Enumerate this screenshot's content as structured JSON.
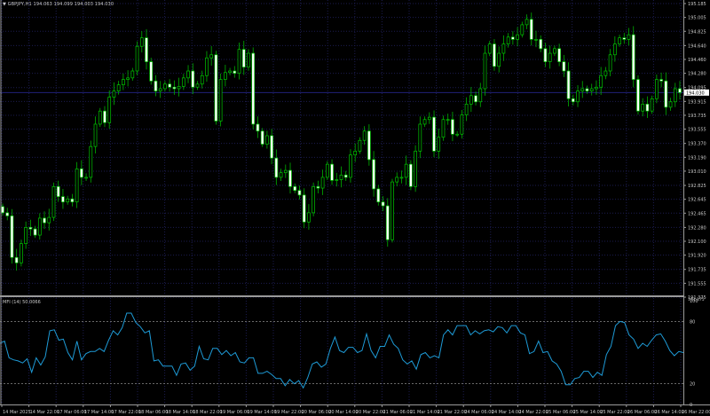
{
  "header": {
    "collapse_icon": "triangle-down-icon",
    "symbol": "GBPJPY,H1",
    "ohlc": "194.063 194.099 194.003 194.030"
  },
  "colors": {
    "background": "#000000",
    "grid": "#1c1c50",
    "candle_bull": "#00c800",
    "candle_bear_fill": "#ffffff",
    "wick": "#00b000",
    "mfi_line": "#1e9bd7",
    "current_price_line": "#20207a",
    "axis_text": "#c8c8c8"
  },
  "price_axis": {
    "labels": [
      "195.185",
      "195.005",
      "194.825",
      "194.640",
      "194.460",
      "194.280",
      "194.095",
      "193.915",
      "193.735",
      "193.555",
      "193.370",
      "193.190",
      "193.010",
      "192.825",
      "192.645",
      "192.465",
      "192.280",
      "192.100",
      "191.920",
      "191.735",
      "191.555",
      "191.375"
    ],
    "current_price": "194.030",
    "range": [
      191.375,
      195.185
    ]
  },
  "indicator": {
    "label": "MFI (14) 50.0066",
    "axis_labels": [
      "100",
      "80",
      "20",
      "0"
    ],
    "levels": [
      80,
      20
    ],
    "range": [
      0,
      100
    ],
    "sub_axis_top_label": "191.375"
  },
  "time_axis": {
    "labels": [
      "14 Mar 2025",
      "14 Mar 22:00",
      "17 Mar 06:00",
      "17 Mar 14:00",
      "17 Mar 22:00",
      "18 Mar 06:00",
      "18 Mar 14:00",
      "18 Mar 22:00",
      "19 Mar 06:00",
      "19 Mar 14:00",
      "19 Mar 22:00",
      "20 Mar 06:00",
      "20 Mar 14:00",
      "20 Mar 22:00",
      "21 Mar 06:00",
      "21 Mar 14:00",
      "21 Mar 22:00",
      "24 Mar 06:00",
      "24 Mar 14:00",
      "24 Mar 22:00",
      "25 Mar 06:00",
      "25 Mar 14:00",
      "25 Mar 22:00",
      "26 Mar 06:00",
      "26 Mar 14:00",
      "26 Mar 22:00"
    ]
  },
  "chart_data": [
    {
      "type": "candlestick",
      "series_name": "GBPJPY,H1",
      "ylim": [
        191.375,
        195.185
      ],
      "grid": true,
      "close": [
        192.47,
        192.43,
        191.89,
        191.82,
        192.07,
        192.28,
        192.26,
        192.18,
        192.4,
        192.34,
        192.41,
        192.81,
        192.68,
        192.61,
        192.65,
        192.61,
        193.04,
        192.93,
        192.93,
        193.33,
        193.62,
        193.79,
        193.64,
        193.97,
        194.05,
        194.13,
        194.2,
        194.22,
        194.31,
        194.63,
        194.74,
        194.43,
        194.18,
        194.05,
        194.08,
        194.14,
        194.1,
        194.08,
        194.11,
        194.22,
        194.31,
        194.1,
        194.14,
        194.25,
        194.48,
        194.52,
        193.66,
        194.2,
        194.29,
        194.31,
        194.28,
        194.59,
        194.36,
        194.54,
        193.62,
        193.53,
        193.36,
        193.47,
        193.18,
        192.93,
        192.99,
        193.02,
        192.81,
        192.76,
        192.7,
        192.35,
        192.47,
        192.81,
        192.79,
        192.93,
        193.1,
        192.89,
        192.9,
        192.96,
        192.93,
        193.22,
        193.27,
        193.41,
        193.53,
        193.16,
        192.78,
        192.61,
        192.56,
        192.12,
        192.87,
        192.93,
        192.93,
        193.1,
        192.81,
        193.27,
        193.62,
        193.68,
        193.71,
        193.27,
        193.45,
        193.68,
        193.68,
        193.49,
        193.49,
        193.74,
        193.88,
        193.99,
        193.91,
        194.08,
        194.54,
        194.66,
        194.37,
        194.54,
        194.66,
        194.75,
        194.72,
        194.78,
        194.91,
        194.98,
        194.72,
        194.72,
        194.6,
        194.43,
        194.54,
        194.6,
        194.43,
        194.31,
        193.95,
        193.91,
        194.05,
        194.08,
        194.05,
        194.08,
        194.1,
        194.25,
        194.31,
        194.52,
        194.66,
        194.74,
        194.72,
        194.78,
        194.2,
        193.79,
        193.88,
        193.79,
        193.95,
        194.2,
        194.18,
        193.84,
        193.91,
        194.08,
        194.03
      ]
    },
    {
      "type": "line",
      "series_name": "MFI (14)",
      "ylim": [
        0,
        100
      ],
      "values": [
        59,
        61,
        45,
        43,
        42,
        40,
        44,
        31,
        45,
        38,
        46,
        71,
        72,
        62,
        63,
        50,
        43,
        61,
        43,
        49,
        51,
        51,
        54,
        51,
        62,
        71,
        67,
        74,
        88,
        88,
        79,
        75,
        69,
        71,
        42,
        43,
        37,
        37,
        37,
        28,
        39,
        40,
        33,
        37,
        56,
        44,
        43,
        54,
        54,
        48,
        52,
        47,
        50,
        41,
        40,
        45,
        45,
        30,
        30,
        32,
        29,
        25,
        25,
        18,
        24,
        20,
        23,
        16,
        26,
        39,
        41,
        36,
        39,
        54,
        65,
        52,
        50,
        55,
        55,
        50,
        52,
        68,
        52,
        45,
        56,
        56,
        67,
        58,
        54,
        43,
        39,
        42,
        34,
        48,
        50,
        45,
        47,
        45,
        67,
        72,
        67,
        76,
        76,
        76,
        67,
        71,
        68,
        71,
        72,
        70,
        75,
        74,
        69,
        76,
        76,
        69,
        67,
        49,
        51,
        61,
        50,
        51,
        42,
        39,
        32,
        19,
        19,
        25,
        26,
        32,
        32,
        26,
        31,
        28,
        48,
        56,
        76,
        80,
        79,
        67,
        63,
        54,
        59,
        56,
        62,
        67,
        68,
        61,
        52,
        47,
        51,
        50
      ]
    }
  ]
}
